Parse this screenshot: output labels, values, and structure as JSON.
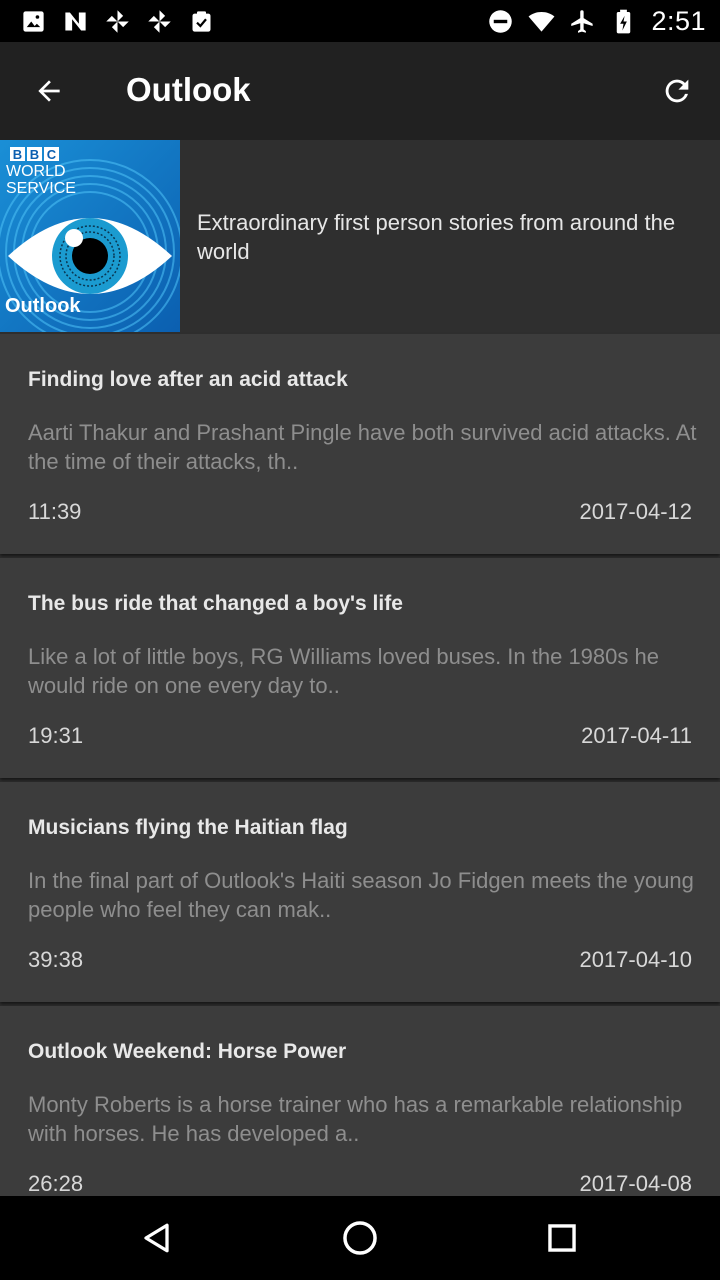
{
  "status_bar": {
    "time": "2:51",
    "left_icons": [
      "image-notification-icon",
      "n-notification-icon",
      "pinwheel-notification-icon",
      "pinwheel-notification-icon",
      "clipboard-check-notification-icon"
    ],
    "right_icons": [
      "do-not-disturb-icon",
      "wifi-icon",
      "airplane-mode-icon",
      "battery-icon"
    ]
  },
  "app_bar": {
    "title": "Outlook",
    "back_icon": "arrow-back-icon",
    "refresh_icon": "refresh-icon"
  },
  "podcast": {
    "cover_brand_line1": "BBC",
    "cover_brand_line2": "WORLD",
    "cover_brand_line3": "SERVICE",
    "cover_title": "Outlook",
    "description": "Extraordinary first person stories from around the world"
  },
  "episodes": [
    {
      "title": "Finding love after an acid attack",
      "description": "Aarti Thakur and Prashant Pingle have both survived acid attacks. At the time of their attacks, th..",
      "duration": "11:39",
      "date": "2017-04-12"
    },
    {
      "title": "The bus ride that changed a boy's life",
      "description": "Like a lot of little boys, RG Williams loved buses. In the 1980s he would ride on one every day to..",
      "duration": "19:31",
      "date": "2017-04-11"
    },
    {
      "title": "Musicians flying the Haitian flag",
      "description": "In the final part of Outlook's Haiti season Jo Fidgen meets the young people who feel they can mak..",
      "duration": "39:38",
      "date": "2017-04-10"
    },
    {
      "title": "Outlook Weekend: Horse Power",
      "description": "Monty Roberts is a horse trainer who has a remarkable relationship with horses. He has developed a..",
      "duration": "26:28",
      "date": "2017-04-08"
    }
  ],
  "nav_bar": {
    "back_icon": "nav-back-icon",
    "home_icon": "nav-home-icon",
    "recents_icon": "nav-recents-icon"
  },
  "colors": {
    "app_bar": "#212121",
    "background": "#2f2f2f",
    "card": "#3c3c3c",
    "title_text": "#e8e8e8",
    "description_text": "#8e8e8e"
  }
}
